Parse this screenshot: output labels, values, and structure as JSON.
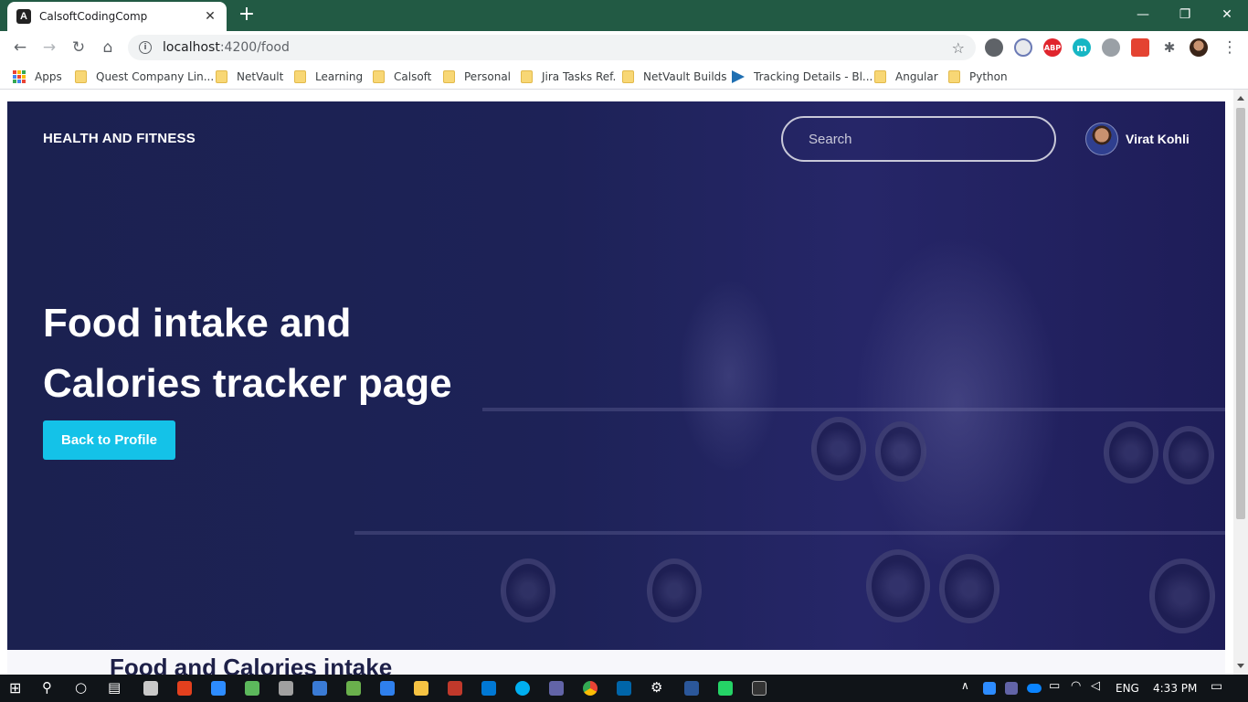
{
  "browser": {
    "tab_title": "CalsoftCodingComp",
    "tab_favicon": "A",
    "url_host": "localhost",
    "url_path": ":4200/food",
    "bookmarks": [
      "Apps",
      "Quest Company Lin...",
      "NetVault",
      "Learning",
      "Calsoft",
      "Personal",
      "Jira Tasks Ref.",
      "NetVault Builds",
      "Tracking Details - Bl...",
      "Angular",
      "Python"
    ],
    "extensions": [
      "ABP",
      "m"
    ]
  },
  "page": {
    "brand": "HEALTH AND FITNESS",
    "search_placeholder": "Search",
    "user_name": "Virat Kohli",
    "hero_title_line1": "Food intake and",
    "hero_title_line2": "Calories tracker page",
    "back_button": "Back to Profile",
    "section_title": "Food and Calories intake"
  },
  "taskbar": {
    "language": "ENG",
    "time": "4:33 PM"
  },
  "colors": {
    "tabbar": "#225a44",
    "hero_bg": "#1d2257",
    "accent_button": "#14c2e8",
    "section_title": "#1e2048"
  }
}
